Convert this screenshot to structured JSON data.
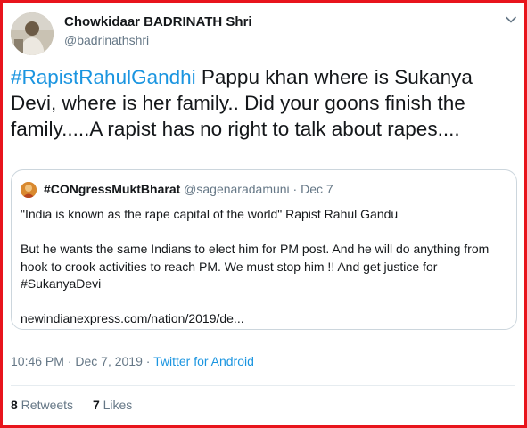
{
  "author": {
    "display_name": "Chowkidaar BADRINATH Shri",
    "handle": "@badrinathshri"
  },
  "tweet": {
    "hashtag": "#RapistRahulGandhi",
    "text": "  Pappu khan where is Sukanya Devi, where is her  family.. Did your goons finish the family.....A rapist has no right to talk about rapes...."
  },
  "quoted_tweet": {
    "display_name": "#CONgressMuktBharat",
    "handle": "@sagenaradamuni",
    "separator": " · ",
    "date": "Dec 7",
    "line1": "\"India is known as the rape capital of the world\" Rapist Rahul Gandu",
    "line2": "But he wants the same Indians to elect him for PM post. And he will do anything from hook to crook activities to reach PM. We must stop him !! And get justice for #SukanyaDevi",
    "link": "newindianexpress.com/nation/2019/de..."
  },
  "timestamp": {
    "time": "10:46 PM · Dec 7, 2019",
    "separator": " · ",
    "source": "Twitter for Android"
  },
  "stats": {
    "retweets_count": "8",
    "retweets_label": " Retweets",
    "likes_count": "7",
    "likes_label": " Likes"
  },
  "icons": {
    "menu": "chevron-down-icon"
  },
  "colors": {
    "link": "#1b95e0",
    "secondary_text": "#657786",
    "frame": "#e8141c"
  }
}
